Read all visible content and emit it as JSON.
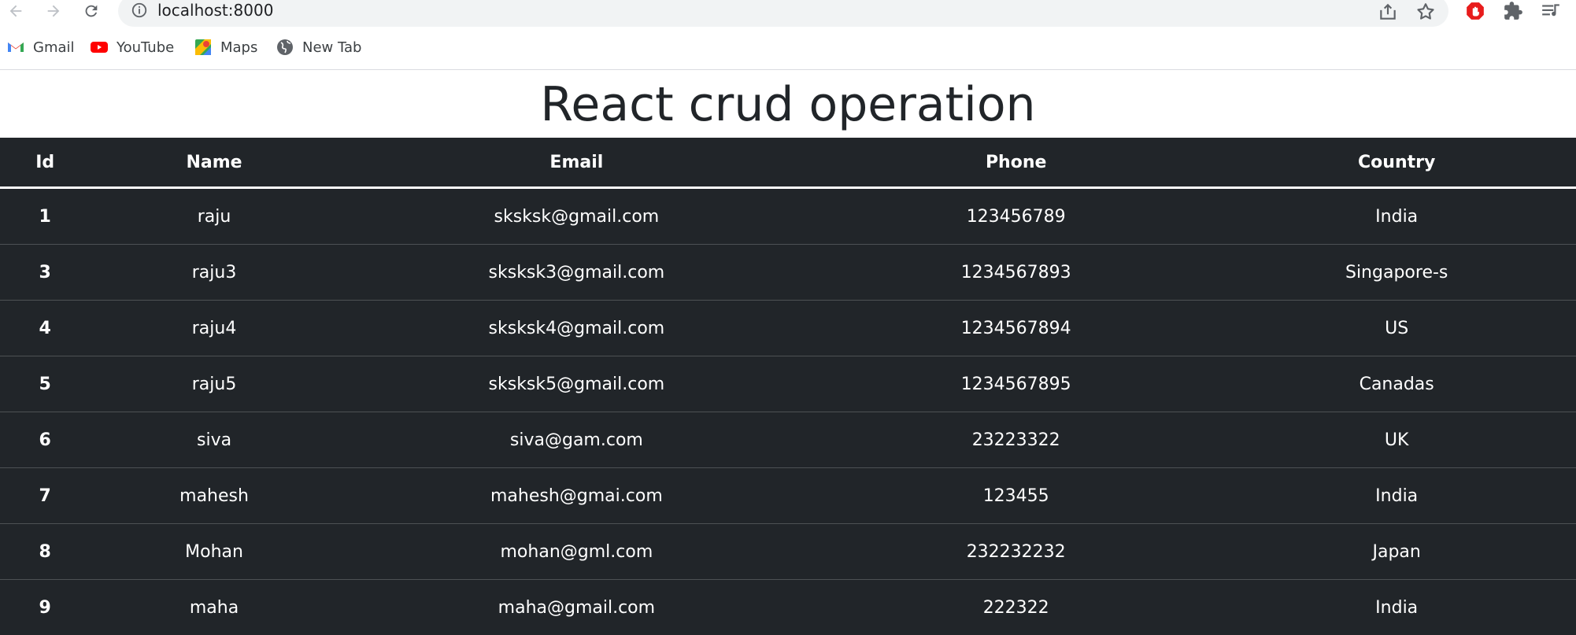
{
  "browser": {
    "url": "localhost:8000",
    "bookmarks": [
      {
        "label": "Gmail",
        "icon": "gmail-icon"
      },
      {
        "label": "YouTube",
        "icon": "youtube-icon"
      },
      {
        "label": "Maps",
        "icon": "maps-icon"
      },
      {
        "label": "New Tab",
        "icon": "globe-icon"
      }
    ]
  },
  "page": {
    "title": "React crud operation"
  },
  "table": {
    "headers": [
      "Id",
      "Name",
      "Email",
      "Phone",
      "Country"
    ],
    "rows": [
      [
        "1",
        "raju",
        "sksksk@gmail.com",
        "123456789",
        "India"
      ],
      [
        "3",
        "raju3",
        "sksksk3@gmail.com",
        "1234567893",
        "Singapore-s"
      ],
      [
        "4",
        "raju4",
        "sksksk4@gmail.com",
        "1234567894",
        "US"
      ],
      [
        "5",
        "raju5",
        "sksksk5@gmail.com",
        "1234567895",
        "Canadas"
      ],
      [
        "6",
        "siva",
        "siva@gam.com",
        "23223322",
        "UK"
      ],
      [
        "7",
        "mahesh",
        "mahesh@gmai.com",
        "123455",
        "India"
      ],
      [
        "8",
        "Mohan",
        "mohan@gml.com",
        "232232232",
        "Japan"
      ],
      [
        "9",
        "maha",
        "maha@gmail.com",
        "222322",
        "India"
      ]
    ]
  },
  "colors": {
    "table_bg": "#212529",
    "table_text": "#ffffff",
    "title_text": "#212529"
  }
}
